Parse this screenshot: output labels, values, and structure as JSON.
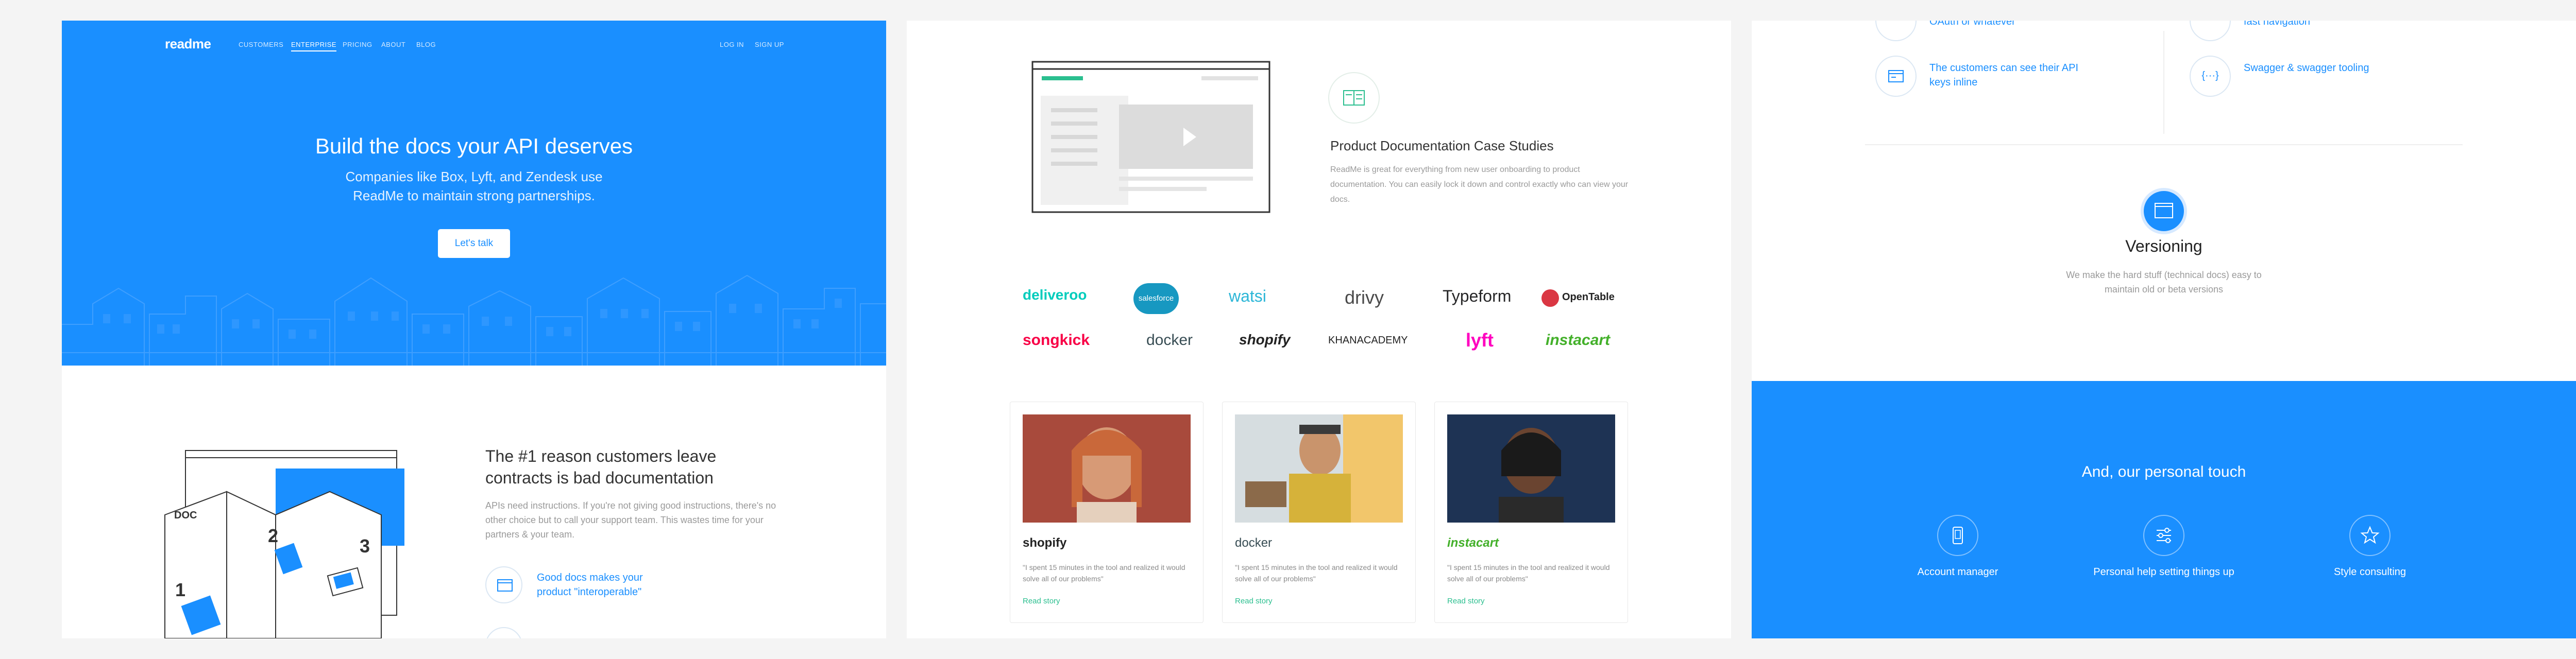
{
  "nav": {
    "logo": "readme",
    "links": [
      "CUSTOMERS",
      "ENTERPRISE",
      "PRICING",
      "ABOUT",
      "BLOG"
    ],
    "login": "LOG IN",
    "signup": "SIGN UP"
  },
  "hero": {
    "title": "Build the docs your API deserves",
    "subtitle": "Companies like Box, Lyft, and Zendesk use ReadMe to maintain strong partnerships.",
    "cta": "Let's talk"
  },
  "reason": {
    "title": "The #1 reason customers leave contracts is bad documentation",
    "body": "APIs need instructions. If you're not giving good instructions, there's no other choice but to call your support team. This wastes time for your partners & your team.",
    "feature": "Good docs makes your product \"interoperable\"",
    "doc_label": "DOC",
    "steps": [
      "1",
      "2",
      "3"
    ]
  },
  "case_studies": {
    "title": "Product Documentation Case Studies",
    "body": "ReadMe is great for everything from new user onboarding to product documentation. You can easily lock it down and control exactly who can view your docs."
  },
  "logos": [
    "deliveroo",
    "salesforce",
    "watsi",
    "drivy",
    "Typeform",
    "OpenTable",
    "songkick",
    "docker",
    "shopify",
    "KHANACADEMY",
    "lyft",
    "instacart"
  ],
  "stories": [
    {
      "brand": "shopify",
      "quote": "\"I spent 15 minutes in the tool and realized it would solve all of our problems\"",
      "read": "Read story"
    },
    {
      "brand": "docker",
      "quote": "\"I spent 15 minutes in the tool and realized it would solve all of our problems\"",
      "read": "Read story"
    },
    {
      "brand": "instacart",
      "quote": "\"I spent 15 minutes in the tool and realized it would solve all of our problems\"",
      "read": "Read story"
    }
  ],
  "features": {
    "top_left": "OAuth or whatever",
    "top_right": "fast navigation",
    "api_keys": "The customers can see their API keys inline",
    "swagger": "Swagger & swagger tooling",
    "swagger_glyph": "{···}"
  },
  "versioning": {
    "title": "Versioning",
    "body": "We make the hard stuff (technical docs) easy to maintain old or beta versions"
  },
  "personal": {
    "title": "And, our personal touch",
    "items": [
      "Account manager",
      "Personal help setting things up",
      "Style consulting"
    ]
  },
  "colors": {
    "brand_blue": "#1a8fff",
    "green": "#2bbf8f",
    "page_bg": "#f4f4f4"
  }
}
